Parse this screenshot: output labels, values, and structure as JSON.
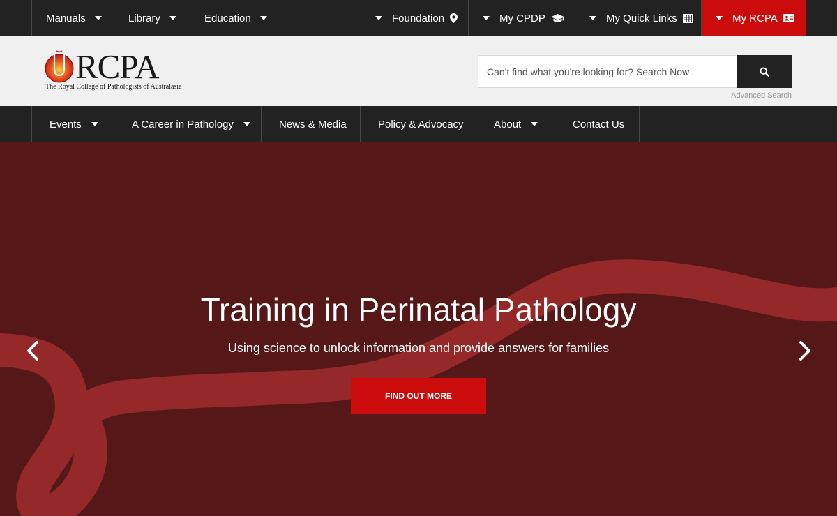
{
  "topbar": {
    "left_items": [
      {
        "label": "Manuals"
      },
      {
        "label": "Library"
      },
      {
        "label": "Education"
      }
    ],
    "right_items": [
      {
        "label": "Foundation",
        "icon": "map-marker-icon"
      },
      {
        "label": "My CPDP",
        "icon": "graduation-cap-icon"
      },
      {
        "label": "My Quick Links",
        "icon": "grid-icon"
      },
      {
        "label": "My RCPA",
        "icon": "id-card-icon"
      }
    ]
  },
  "header": {
    "logo_text": "RCPA",
    "logo_subtitle": "The Royal College of Pathologists of Australasia",
    "search_placeholder": "Can't find what you're looking for? Search Now",
    "search_icon": "search-icon",
    "advanced_search": "Advanced Search"
  },
  "mainnav": {
    "items": [
      {
        "label": "Events"
      },
      {
        "label": "A Career in Pathology"
      },
      {
        "label": "News & Media"
      },
      {
        "label": "Policy & Advocacy"
      },
      {
        "label": "About"
      },
      {
        "label": "Contact Us"
      }
    ]
  },
  "hero": {
    "title": "Training in Perinatal Pathology",
    "subtitle": "Using science to unlock information and provide answers for families",
    "button_label": "FIND OUT MORE",
    "prev_icon": "chevron-left-icon",
    "next_icon": "chevron-right-icon"
  },
  "colors": {
    "topbar_bg": "#222222",
    "accent_red": "#cc0c0c",
    "hero_bg": "#561718",
    "ribbon": "#952829",
    "header_bg": "#f0f0f0"
  }
}
